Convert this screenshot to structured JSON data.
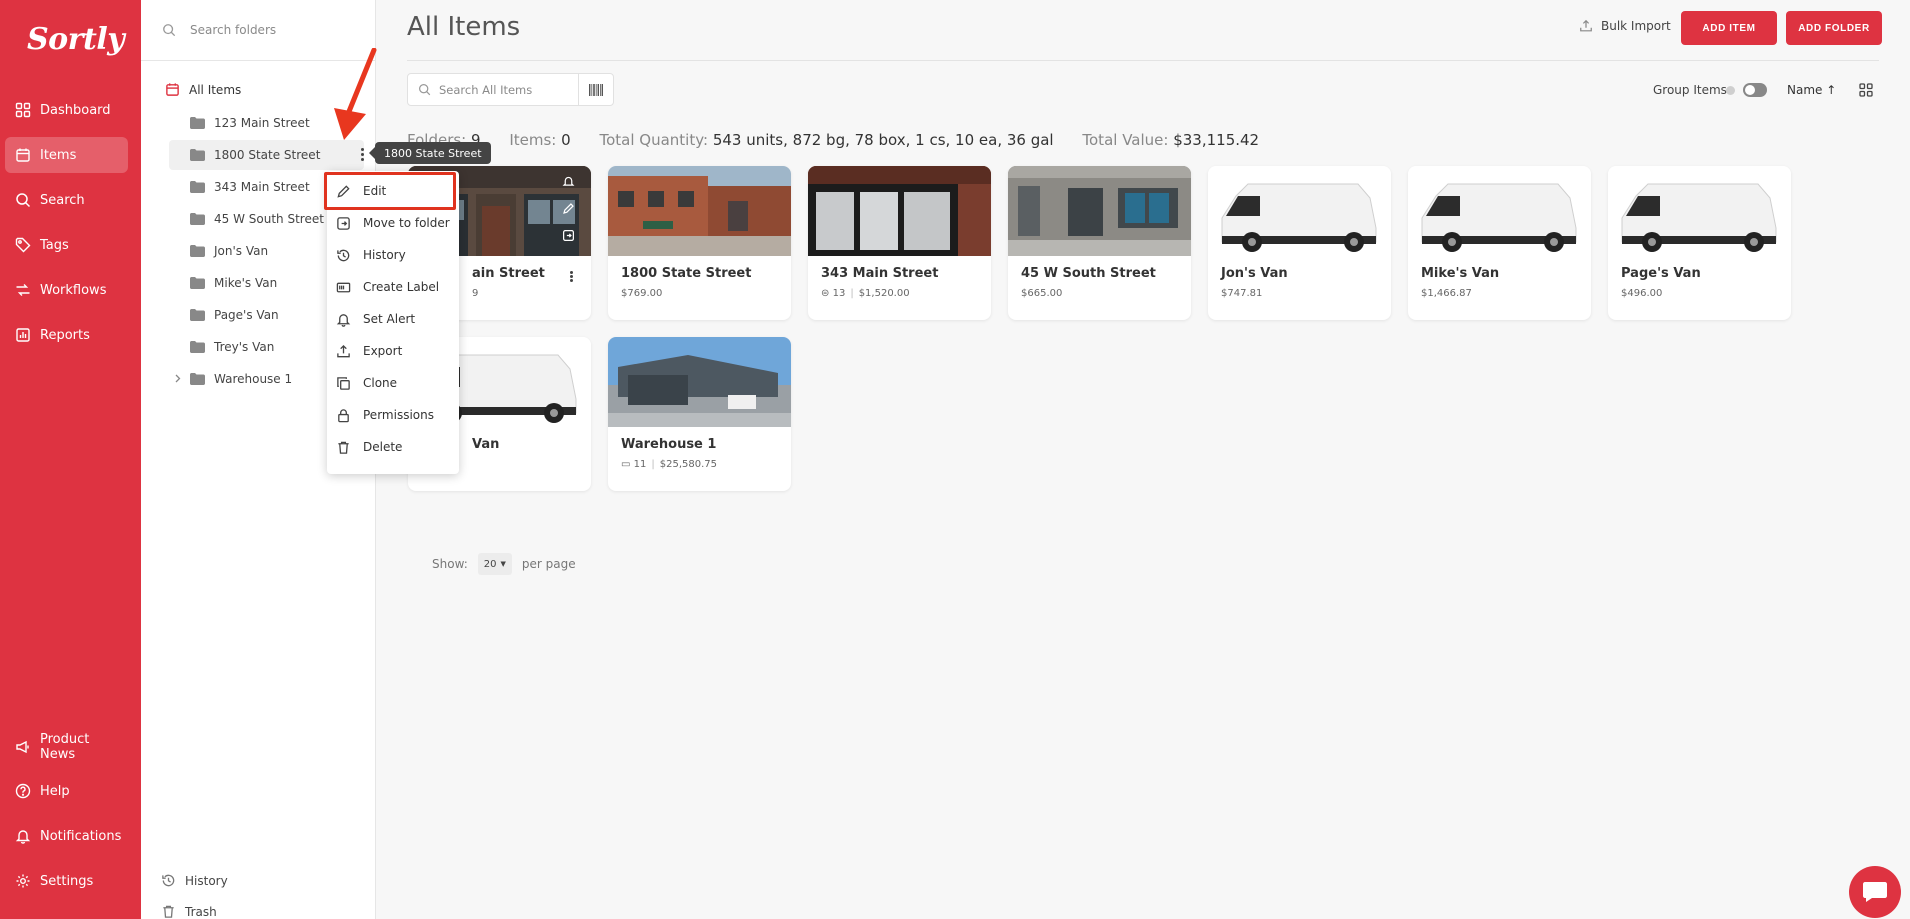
{
  "app": {
    "logo": "Sortly",
    "nav": [
      {
        "label": "Dashboard",
        "icon": "dashboard-icon"
      },
      {
        "label": "Items",
        "icon": "items-icon",
        "active": true
      },
      {
        "label": "Search",
        "icon": "search-icon"
      },
      {
        "label": "Tags",
        "icon": "tag-icon"
      },
      {
        "label": "Workflows",
        "icon": "workflow-icon"
      },
      {
        "label": "Reports",
        "icon": "reports-icon"
      }
    ],
    "nav_bottom": [
      {
        "label": "Product News",
        "icon": "megaphone-icon"
      },
      {
        "label": "Help",
        "icon": "help-icon"
      },
      {
        "label": "Notifications",
        "icon": "bell-icon"
      },
      {
        "label": "Settings",
        "icon": "gear-icon"
      }
    ],
    "brand_color": "#de3341"
  },
  "folder_panel": {
    "search_placeholder": "Search folders",
    "all_items": "All Items",
    "folders": [
      "123 Main Street",
      "1800 State Street",
      "343 Main Street",
      "45 W South Street",
      "Jon's Van",
      "Mike's Van",
      "Page's Van",
      "Trey's Van",
      "Warehouse 1"
    ],
    "footer": [
      {
        "label": "History",
        "icon": "history-icon"
      },
      {
        "label": "Trash",
        "icon": "trash-icon"
      }
    ]
  },
  "tooltip": "1800 State Street",
  "context_menu": [
    {
      "label": "Edit",
      "icon": "pencil-icon"
    },
    {
      "label": "Move to folder",
      "icon": "move-folder-icon"
    },
    {
      "label": "History",
      "icon": "history-icon"
    },
    {
      "label": "Create Label",
      "icon": "label-icon"
    },
    {
      "label": "Set Alert",
      "icon": "alert-bell-icon"
    },
    {
      "label": "Export",
      "icon": "export-icon"
    },
    {
      "label": "Clone",
      "icon": "clone-icon"
    },
    {
      "label": "Permissions",
      "icon": "lock-icon"
    },
    {
      "label": "Delete",
      "icon": "trash-icon"
    }
  ],
  "main": {
    "title": "All Items",
    "bulk_import": "Bulk Import",
    "add_item": "ADD ITEM",
    "add_folder": "ADD FOLDER",
    "search_placeholder": "Search All Items",
    "group_items": "Group Items",
    "sort_label": "Name",
    "summary": {
      "folders_label": "Folders:",
      "folders_value": "9",
      "items_label": "Items:",
      "items_value": "0",
      "qty_label": "Total Quantity:",
      "qty_value": "543 units, 872 bg, 78 box, 1 cs, 10 ea, 36 gal",
      "value_label": "Total Value:",
      "value_value": "$33,115.42"
    },
    "cards": [
      {
        "name": "ain Street",
        "sub": "9",
        "image": "storefront-brick"
      },
      {
        "name": "1800 State Street",
        "sub": "$769.00",
        "image": "brick-building"
      },
      {
        "name": "343 Main Street",
        "count": "13",
        "value": "$1,520.00",
        "image": "black-storefront"
      },
      {
        "name": "45 W South Street",
        "sub": "$665.00",
        "image": "grey-building"
      },
      {
        "name": "Jon's Van",
        "sub": "$747.81",
        "image": "white-van"
      },
      {
        "name": "Mike's Van",
        "sub": "$1,466.87",
        "image": "white-van"
      },
      {
        "name": "Page's Van",
        "sub": "$496.00",
        "image": "white-van"
      },
      {
        "name": "Van",
        "sub": "",
        "image": "white-van"
      },
      {
        "name": "Warehouse 1",
        "count": "11",
        "value": "$25,580.75",
        "image": "warehouse"
      }
    ],
    "pager": {
      "show": "Show:",
      "value": "20",
      "per_page": "per page"
    }
  }
}
